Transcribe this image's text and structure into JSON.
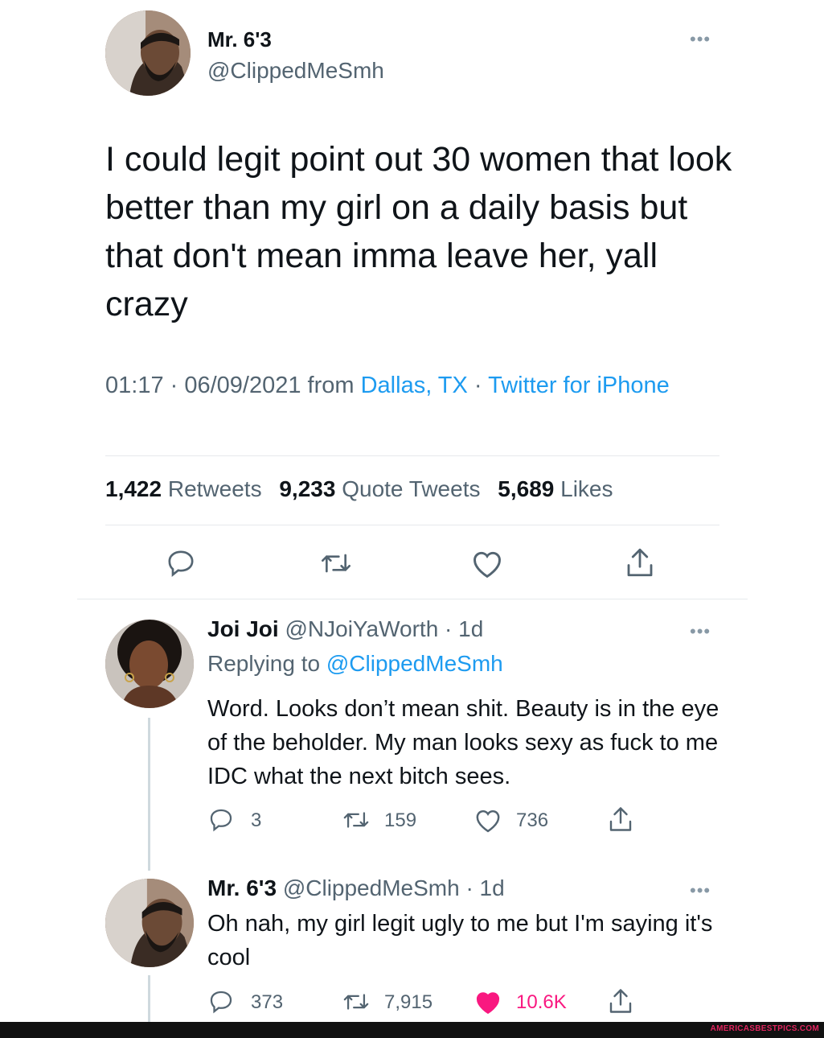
{
  "main_tweet": {
    "author_name": "Mr. 6'3",
    "author_handle": "@ClippedMeSmh",
    "more_label": "•••",
    "text": "I could legit point out 30 women that look better than my girl on a daily basis but that don't mean imma leave her, yall crazy",
    "time": "01:17 · 06/09/2021 from ",
    "location": "Dallas, TX",
    "sep": " · ",
    "source": "Twitter for iPhone",
    "stats": {
      "retweets_count": "1,422",
      "retweets_label": "Retweets",
      "quotes_count": "9,233",
      "quotes_label": "Quote Tweets",
      "likes_count": "5,689",
      "likes_label": "Likes"
    }
  },
  "replies": [
    {
      "author_name": "Joi Joi",
      "author_handle": "@NJoiYaWorth",
      "age": "· 1d",
      "replying_prefix": "Replying to ",
      "replying_to": "@ClippedMeSmh",
      "text": "Word. Looks don’t mean shit. Beauty is in the eye of the beholder. My man looks sexy as fuck to me IDC what the next bitch sees.",
      "replies": "3",
      "retweets": "159",
      "likes": "736",
      "liked": false
    },
    {
      "author_name": "Mr. 6'3",
      "author_handle": "@ClippedMeSmh",
      "age": "· 1d",
      "text": "Oh nah, my girl legit ugly to me but I'm saying it's cool",
      "replies": "373",
      "retweets": "7,915",
      "likes": "10.6K",
      "liked": true
    }
  ],
  "watermark": "AMERICASBESTPICS.COM",
  "colors": {
    "link": "#1d9bf0",
    "like": "#f91880",
    "muted": "#536471"
  }
}
